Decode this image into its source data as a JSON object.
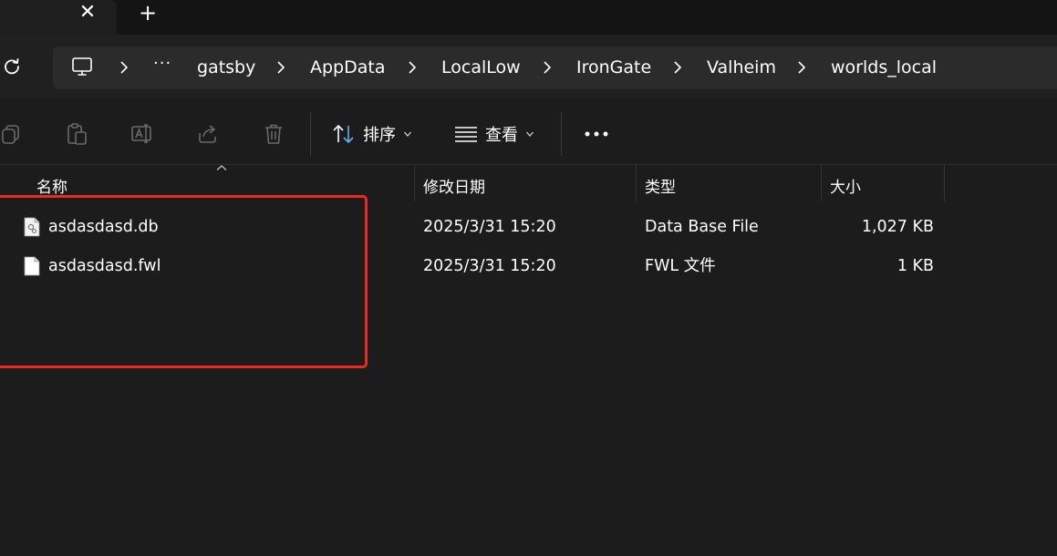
{
  "tabbar": {
    "close_glyph": "✕",
    "new_tab_glyph": "+"
  },
  "address": {
    "more_glyph": "···",
    "breadcrumbs": [
      "gatsby",
      "AppData",
      "LocalLow",
      "IronGate",
      "Valheim",
      "worlds_local"
    ]
  },
  "toolbar": {
    "sort_label": "排序",
    "view_label": "查看",
    "icons": [
      "copy-icon",
      "paste-icon",
      "rename-icon",
      "share-icon",
      "delete-icon",
      "sort-icon",
      "view-icon",
      "more-icon"
    ]
  },
  "columns": {
    "name": "名称",
    "modified": "修改日期",
    "type": "类型",
    "size": "大小"
  },
  "files": [
    {
      "name": "asdasdasd.db",
      "modified": "2025/3/31 15:20",
      "type": "Data Base File",
      "size": "1,027 KB",
      "icon": "db-file-icon"
    },
    {
      "name": "asdasdasd.fwl",
      "modified": "2025/3/31 15:20",
      "type": "FWL 文件",
      "size": "1 KB",
      "icon": "file-icon"
    }
  ],
  "colors": {
    "background": "#1c1c1c",
    "highlight": "#e82a24",
    "address_bg": "#2b2b2b"
  }
}
